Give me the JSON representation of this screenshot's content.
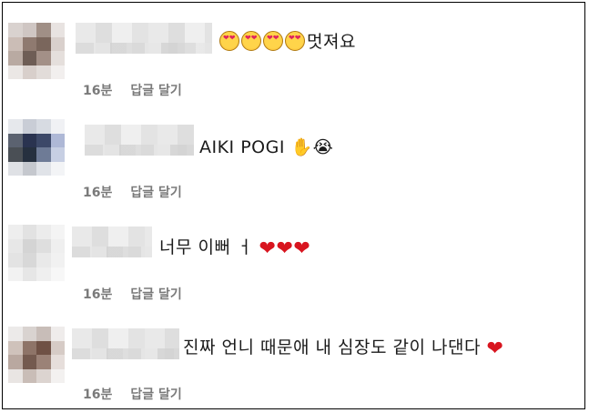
{
  "comments": [
    {
      "text": "멋져요",
      "emoji_prefix": "smiling-face-with-heart-eyes x4",
      "time": "16분",
      "reply_label": "답글 달기"
    },
    {
      "text": "AIKI POGI",
      "emoji_suffix": "✋😭",
      "time": "16분",
      "reply_label": "답글 달기"
    },
    {
      "text": "너무 이뻐 ㅓ",
      "emoji_suffix": "❤❤❤",
      "time": "16분",
      "reply_label": "답글 달기"
    },
    {
      "text": "진짜 언니 때문애 내 심장도 같이 나댄다",
      "emoji_suffix": "❤",
      "time": "16분",
      "reply_label": "답글 달기"
    }
  ]
}
